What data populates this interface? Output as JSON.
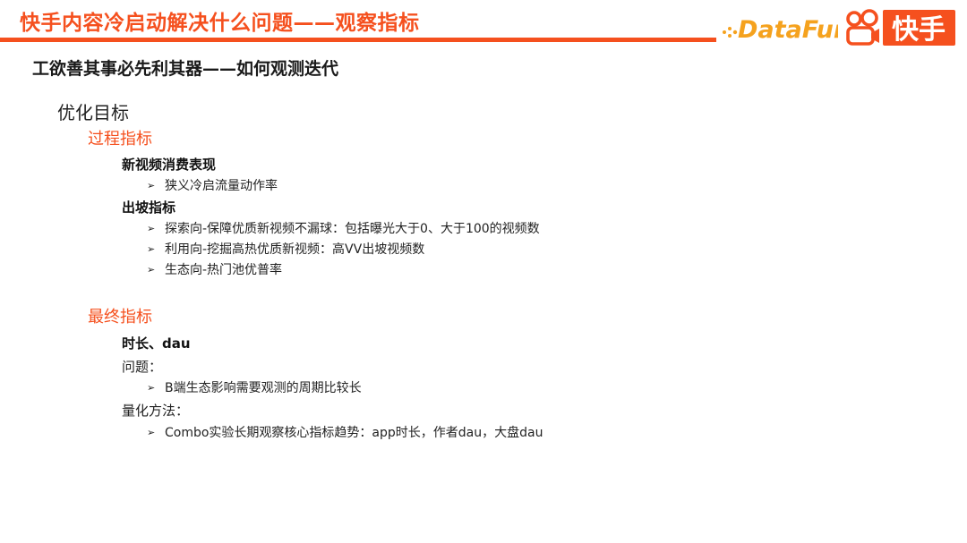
{
  "header": {
    "title": "快手内容冷启动解决什么问题——观察指标",
    "subtitle": "工欲善其事必先利其器——如何观测迭代",
    "accent_color": "#f5501e",
    "logos": {
      "datafun": "DataFun.",
      "kuaishou": "快手"
    }
  },
  "goal_heading": "优化目标",
  "process": {
    "heading": "过程指标",
    "groups": [
      {
        "title": "新视频消费表现",
        "bullets": [
          "狭义冷启流量动作率"
        ]
      },
      {
        "title": "出坡指标",
        "bullets": [
          "探索向-保障优质新视频不漏球：包括曝光大于0、大于100的视频数",
          "利用向-挖掘高热优质新视频：高VV出坡视频数",
          "生态向-热门池优普率"
        ]
      }
    ]
  },
  "final": {
    "heading": "最终指标",
    "group_title": "时长、dau",
    "problem_label": "问题：",
    "problem_bullets": [
      "B端生态影响需要观测的周期比较长"
    ],
    "method_label": "量化方法：",
    "method_bullets": [
      "Combo实验长期观察核心指标趋势：app时长，作者dau，大盘dau"
    ]
  },
  "bullet_glyph": "➢"
}
